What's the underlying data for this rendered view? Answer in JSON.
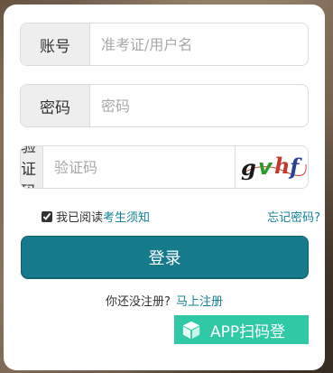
{
  "form": {
    "account": {
      "label": "账号",
      "placeholder": "准考证/用户名"
    },
    "password": {
      "label": "密码",
      "placeholder": "密码"
    },
    "captcha": {
      "label": "验证码",
      "placeholder": "验证码",
      "image_text": "gvhf"
    },
    "agree": {
      "checked": true,
      "prefix": "我已阅读",
      "link": "考生须知"
    },
    "forgot_label": "忘记密码?",
    "login_label": "登录",
    "register": {
      "prompt": "你还没注册?",
      "link": "马上注册"
    },
    "app_scan_label": "APP扫码登"
  },
  "colors": {
    "accent": "#157a8c",
    "link": "#138294",
    "app_button": "#2fc9a6"
  }
}
